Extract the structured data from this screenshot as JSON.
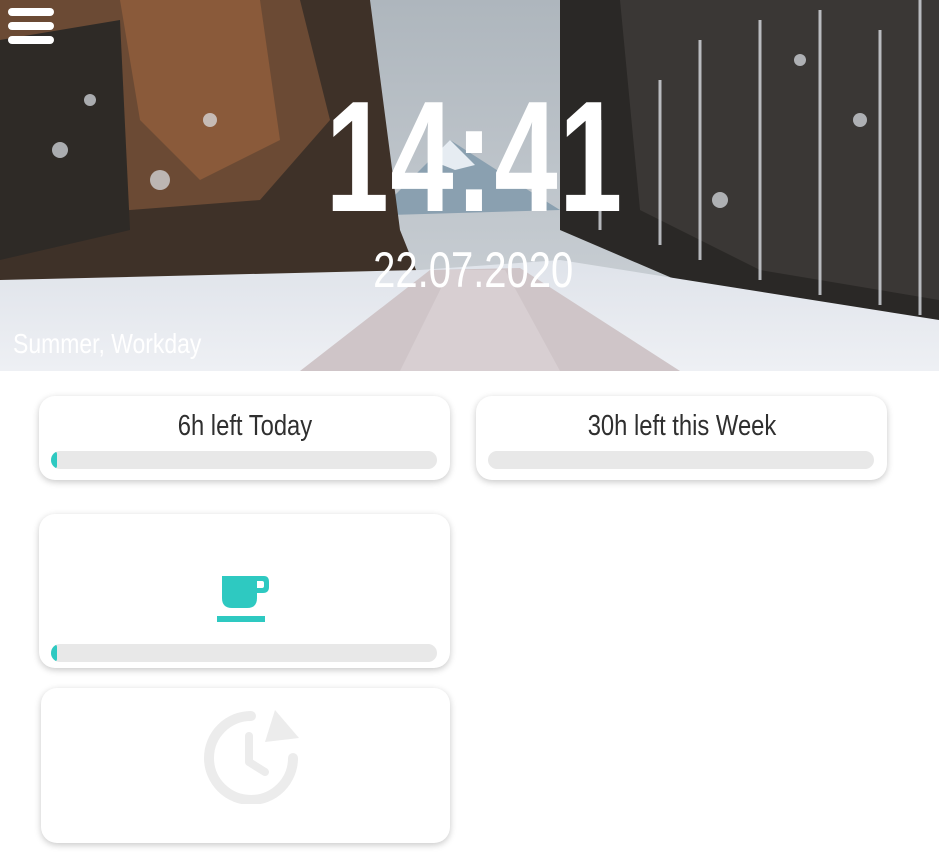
{
  "header": {
    "time": "14:41",
    "date": "22.07.2020",
    "season_label": "Summer, Workday"
  },
  "cards": {
    "today": {
      "label": "6h left Today",
      "progress": 0.01
    },
    "week": {
      "label": "30h left this Week",
      "progress": 0.0
    },
    "break": {
      "icon": "coffee-cup-icon",
      "progress": 0.01
    },
    "history": {
      "icon": "clock-history-icon"
    }
  },
  "colors": {
    "accent": "#2ec9c1",
    "track": "#e8e8e8",
    "muted_icon": "#ececec",
    "text": "#2f2f2f"
  }
}
